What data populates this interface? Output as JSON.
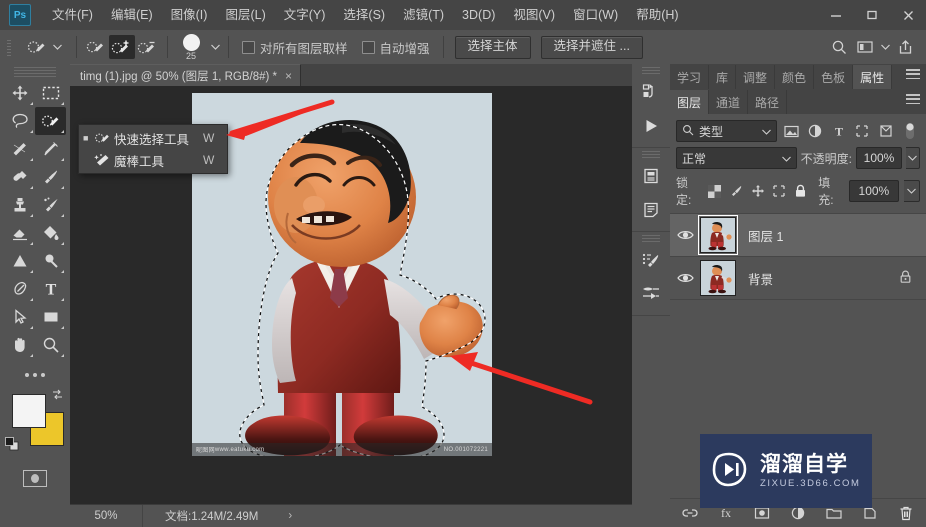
{
  "app": {
    "logo_text": "Ps",
    "menu": [
      {
        "label": "文件(F)"
      },
      {
        "label": "编辑(E)"
      },
      {
        "label": "图像(I)"
      },
      {
        "label": "图层(L)"
      },
      {
        "label": "文字(Y)"
      },
      {
        "label": "选择(S)"
      },
      {
        "label": "滤镜(T)"
      },
      {
        "label": "3D(D)"
      },
      {
        "label": "视图(V)"
      },
      {
        "label": "窗口(W)"
      },
      {
        "label": "帮助(H)"
      }
    ],
    "window_controls": {
      "minimize": "minimize-icon",
      "maximize": "maximize-icon",
      "close": "close-icon"
    }
  },
  "options_bar": {
    "tool_preset_icon": "quick-selection-tool-icon",
    "modes": [
      {
        "name": "new-selection",
        "label": "新选区"
      },
      {
        "name": "add-to-selection",
        "label": "添加到选区",
        "active": true
      },
      {
        "name": "subtract-from-selection",
        "label": "从选区减去"
      }
    ],
    "brush_size": "25",
    "sample_all_layers": {
      "label": "对所有图层取样",
      "checked": false
    },
    "auto_enhance": {
      "label": "自动增强",
      "checked": false
    },
    "select_subject": "选择主体",
    "select_and_mask": "选择并遮住 ...",
    "right_icons": [
      "search-icon",
      "arrange-documents-icon",
      "share-icon"
    ]
  },
  "toolbar": {
    "tools": [
      {
        "name": "move-tool",
        "label": "移动工具"
      },
      {
        "name": "rectangular-marquee-tool",
        "label": "矩形选框工具"
      },
      {
        "name": "lasso-tool",
        "label": "套索工具"
      },
      {
        "name": "quick-selection-tool",
        "label": "快速选择工具",
        "active": true
      },
      {
        "name": "crop-tool",
        "label": "裁剪工具"
      },
      {
        "name": "eyedropper-tool",
        "label": "吸管工具"
      },
      {
        "name": "spot-healing-brush-tool",
        "label": "污点修复画笔工具"
      },
      {
        "name": "brush-tool",
        "label": "画笔工具"
      },
      {
        "name": "clone-stamp-tool",
        "label": "仿制图章工具"
      },
      {
        "name": "history-brush-tool",
        "label": "历史记录画笔工具"
      },
      {
        "name": "eraser-tool",
        "label": "橡皮擦工具"
      },
      {
        "name": "gradient-tool",
        "label": "渐变工具"
      },
      {
        "name": "blur-tool",
        "label": "模糊工具"
      },
      {
        "name": "dodge-tool",
        "label": "减淡工具"
      },
      {
        "name": "pen-tool",
        "label": "钢笔工具"
      },
      {
        "name": "type-tool",
        "label": "横排文字工具"
      },
      {
        "name": "path-selection-tool",
        "label": "路径选择工具"
      },
      {
        "name": "rectangle-tool",
        "label": "矩形工具"
      },
      {
        "name": "hand-tool",
        "label": "抓手工具"
      },
      {
        "name": "zoom-tool",
        "label": "缩放工具"
      }
    ],
    "more_tools": "编辑工具栏",
    "foreground_color": "#f4f4f4",
    "background_color": "#ecc62a",
    "quick_mask": "以快速蒙版模式编辑"
  },
  "tool_flyout": {
    "items": [
      {
        "label": "快速选择工具",
        "shortcut": "W",
        "icon": "quick-selection-tool-icon",
        "selected": true
      },
      {
        "label": "魔棒工具",
        "shortcut": "W",
        "icon": "magic-wand-tool-icon",
        "selected": false
      }
    ]
  },
  "document": {
    "tab_title": "timg (1).jpg @ 50% (图层 1, RGB/8#) *",
    "close_label": "×",
    "canvas_watermarks": {
      "left_cn": "昵图网",
      "left_url": "www.eatuku.com",
      "right_id": "NO.001072221"
    }
  },
  "status_bar": {
    "zoom": "50%",
    "doc_info": "文档:1.24M/2.49M",
    "expand": "›"
  },
  "dock_strip": {
    "buttons": [
      {
        "name": "history-icon"
      },
      {
        "name": "actions-play-icon"
      },
      {
        "name": "info-panel-icon"
      },
      {
        "name": "notes-icon"
      },
      {
        "name": "brush-settings-icon"
      },
      {
        "name": "adjustments-sliders-icon"
      }
    ]
  },
  "panels": {
    "top_tabs": [
      {
        "label": "学习",
        "active": false
      },
      {
        "label": "库",
        "active": false
      },
      {
        "label": "调整",
        "active": false
      },
      {
        "label": "颜色",
        "active": false
      },
      {
        "label": "色板",
        "active": false
      },
      {
        "label": "属性",
        "active": true
      }
    ],
    "bottom_tabs": [
      {
        "label": "图层",
        "active": true
      },
      {
        "label": "通道",
        "active": false
      },
      {
        "label": "路径",
        "active": false
      }
    ],
    "layers": {
      "filter_label": "类型",
      "filter_icons": [
        "filter-pixel-icon",
        "filter-adjustment-icon",
        "filter-type-icon",
        "filter-shape-icon",
        "filter-smart-object-icon"
      ],
      "filter_toggle": "filter-toggle-switch",
      "blend_mode": "正常",
      "opacity_label": "不透明度:",
      "opacity_value": "100%",
      "lock_label": "锁定:",
      "lock_icons": [
        "lock-transparent-pixels-icon",
        "lock-image-pixels-icon",
        "lock-position-icon",
        "lock-artboard-nesting-icon",
        "lock-all-icon"
      ],
      "fill_label": "填充:",
      "fill_value": "100%",
      "rows": [
        {
          "name": "图层 1",
          "visible": true,
          "selected": true,
          "locked": false
        },
        {
          "name": "背景",
          "visible": true,
          "selected": false,
          "locked": true
        }
      ],
      "footer_buttons": [
        {
          "name": "link-layers-icon"
        },
        {
          "name": "layer-style-icon"
        },
        {
          "name": "layer-mask-icon"
        },
        {
          "name": "adjustment-layer-icon"
        },
        {
          "name": "new-group-icon"
        },
        {
          "name": "new-layer-icon"
        },
        {
          "name": "delete-layer-icon"
        }
      ]
    }
  },
  "watermark": {
    "cn": "溜溜自学",
    "en": "ZIXUE.3D66.COM",
    "bg_color": "#2c3a5e"
  },
  "annotations": {
    "arrow_color": "#ee2b24",
    "arrows": [
      {
        "name": "arrow-to-tool-flyout"
      },
      {
        "name": "arrow-to-selection"
      }
    ]
  }
}
